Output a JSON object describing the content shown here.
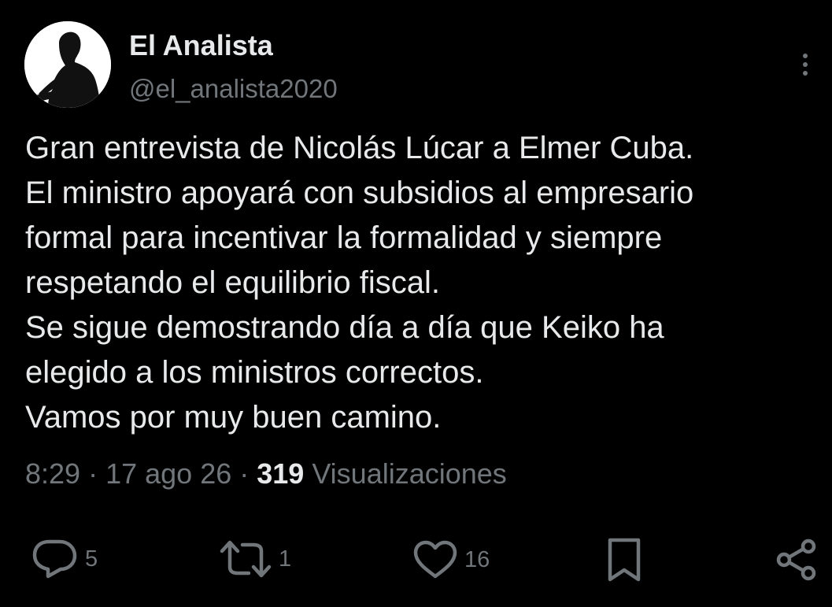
{
  "author": {
    "display_name": "El Analista",
    "handle": "@el_analista2020"
  },
  "tweet": {
    "lines": [
      "Gran entrevista de Nicolás Lúcar a Elmer Cuba.",
      "El ministro apoyará con subsidios al empresario",
      "formal para incentivar la formalidad y siempre",
      "respetando el equilibrio fiscal.",
      "Se sigue demostrando día a día que Keiko ha",
      "elegido a los ministros correctos.",
      "Vamos por muy buen camino."
    ]
  },
  "meta": {
    "time": "8:29",
    "separator": " · ",
    "date": "17 ago 26",
    "views_count": "319",
    "views_label": " Visualizaciones"
  },
  "actions": {
    "replies": "5",
    "reposts": "1",
    "likes": "16"
  },
  "colors": {
    "background": "#000000",
    "primary_text": "#e7e9ea",
    "secondary_text": "#71767b"
  },
  "icons": {
    "more": "more-vertical-icon",
    "reply": "reply-icon",
    "repost": "repost-icon",
    "like": "heart-icon",
    "bookmark": "bookmark-icon",
    "share": "share-icon"
  }
}
